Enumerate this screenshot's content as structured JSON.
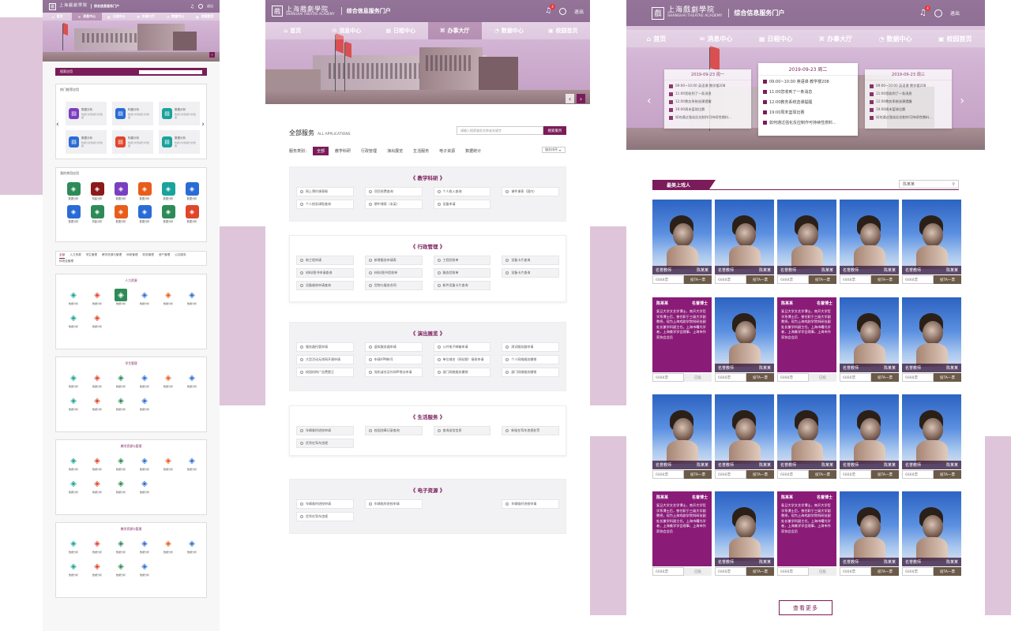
{
  "brand": {
    "cn": "上海戲劇學院",
    "en": "SHANGHAI THEATRE ACADEMY",
    "portal": "综合信息服务门户",
    "logout": "退出",
    "badge": "4",
    "small_title": "综合信息服务门户"
  },
  "nav": [
    {
      "label": "首页",
      "icon": "home-icon"
    },
    {
      "label": "消息中心",
      "icon": "message-icon"
    },
    {
      "label": "日程中心",
      "icon": "calendar-icon"
    },
    {
      "label": "办事大厅",
      "icon": "hall-icon"
    },
    {
      "label": "数据中心",
      "icon": "data-icon"
    },
    {
      "label": "校园首页",
      "icon": "campus-icon"
    }
  ],
  "left": {
    "search_label": "搜索应用",
    "popular_title": "热门推荐应用",
    "popular": [
      {
        "name": "数据分析",
        "desc": "数据分析数据分析数据"
      },
      {
        "name": "构建分析",
        "desc": "数据分析数据分析数据"
      },
      {
        "name": "数据分析",
        "desc": "数据分析数据分析数据"
      },
      {
        "name": "数据分析",
        "desc": "数据分析数据分析数据"
      },
      {
        "name": "构建分析",
        "desc": "数据分析数据分析数据"
      },
      {
        "name": "数据分析",
        "desc": "数据分析数据分析数据"
      }
    ],
    "common_title": "我的常用应用",
    "common": [
      {
        "name": "数据分析",
        "color": "#2e8b57"
      },
      {
        "name": "构建分析",
        "color": "#8b1a1a"
      },
      {
        "name": "数据分析",
        "color": "#7a3fc0"
      },
      {
        "name": "数据分析",
        "color": "#e85d1c"
      },
      {
        "name": "数据分析",
        "color": "#1aa39a"
      },
      {
        "name": "数据分析",
        "color": "#2a6cd6"
      },
      {
        "name": "数据分析",
        "color": "#2a6cd6"
      },
      {
        "name": "构建分析",
        "color": "#2e8b57"
      },
      {
        "name": "数据分析",
        "color": "#e85d1c"
      },
      {
        "name": "数据分析",
        "color": "#2a6cd6"
      },
      {
        "name": "数据分析",
        "color": "#2e8b57"
      },
      {
        "name": "数据分析",
        "color": "#e0462c"
      }
    ],
    "tabs": [
      "全部",
      "人力资源",
      "学生管理",
      "教学资源与管理",
      "科研管理",
      "财务管理",
      "资产管理",
      "公共服务",
      "科研及管理"
    ],
    "groups": [
      {
        "title": "人力资源"
      },
      {
        "title": "学生管理"
      },
      {
        "title": "教学资源与管理"
      },
      {
        "title": "教学资源与管理"
      }
    ],
    "tile_name": "数据分析"
  },
  "mid": {
    "section_title": "全部服务",
    "section_en": "ALL APPLICATIONS",
    "search_placeholder": "请输入搜索服务名称或关键字",
    "search_btn": "搜索服务",
    "filter_label": "服务类别：",
    "filters": [
      "全部",
      "教学科研",
      "行政管理",
      "演出展览",
      "生活服务",
      "电子资源",
      "数据统计"
    ],
    "sort": "服务排序",
    "blocks": [
      {
        "title": "教学科研",
        "items": [
          "网上预约课表制",
          "项目经费查询",
          "个人收入查询",
          "课件课表（国内）",
          "个人校务津贴查询",
          "期中课表（本英）",
          "设备申请"
        ]
      },
      {
        "title": "行政管理",
        "items": [
          "新工程申请",
          "新增服务申请表",
          "工程验收单",
          "设备卡片查询",
          "材料/图书申请查询",
          "材料/图书验收单",
          "服务验收单",
          "设备卡片查询",
          "设备维修申请查询",
          "货物与服务合同",
          "新件设备卡片查询"
        ]
      },
      {
        "title": "演出展览",
        "items": [
          "服务器托管申请",
          "虚拟服务器申请",
          "公共电子邮箱申请",
          "测试服务器申请",
          "大型活动无线网开通申请",
          "申请VPN帐号",
          "单位域名（网站群）接收申请",
          "个人网络服务撤销",
          "校园机构广告费更正",
          "党机或名及外网IP地址申请",
          "部门网络服务撤销",
          "部门网络服务撤销"
        ]
      },
      {
        "title": "生活服务",
        "items": [
          "车辆临时进校申请",
          "校园违章记录查询",
          "查询送信信息",
          "新临在驾车违规处罚",
          "优秀在驾车违规"
        ]
      },
      {
        "title": "电子资源",
        "items": [
          "车辆临时进校申请",
          "车辆临时进校申请",
          "",
          "车辆临时进校申请",
          "优秀在驾车违规"
        ]
      }
    ]
  },
  "right": {
    "schedules": [
      {
        "date": "2019-09-23 周二",
        "items": [
          "09:00~10:00 英语课 教学楼208",
          "11:00您收到了一条消息",
          "12:00教务系统选课提醒",
          "19:00周末篮球比赛",
          "如何通过强化反应制作可持续性燃料..."
        ]
      },
      {
        "date": "2019-09-23 周一",
        "items": [
          "09:00~10:00 英语课 教学楼208",
          "11:00您收到了一条消息",
          "12:00教务系统选课提醒",
          "19:00周末篮球比赛",
          "如何通过强化反应制作可持续性燃料..."
        ]
      },
      {
        "date": "2019-09-23 周三",
        "items": [
          "09:00~10:00 英语课 教学楼208",
          "11:00您收到了一条消息",
          "12:00教务系统选课提醒",
          "19:00周末篮球比赛",
          "如何通过强化反应制作可持续性燃料..."
        ]
      }
    ],
    "section_title": "最美上戏人",
    "search_placeholder": "陈某某",
    "person": {
      "title": "名誉教师",
      "name": "陈某某",
      "role": "名誉博士",
      "bio": "复旦大学文艺学博士，南开大学哲学系博士后，曾任职于三级大学副教授，现为上海戏剧学院科研处副处长兼学科副主任。上海市曙光学者，上海美学学会理事，上海市作家协会会员"
    },
    "vote_count": "6888票",
    "vote_btn": "投TA一票",
    "voted": "已投",
    "grid_layout": [
      [
        "p",
        "p",
        "p",
        "p",
        "p"
      ],
      [
        "b",
        "p",
        "b",
        "p",
        "p"
      ],
      [
        "p",
        "p",
        "p",
        "p",
        "p"
      ],
      [
        "b",
        "p",
        "b",
        "p",
        "p"
      ]
    ],
    "grid_voted": [
      [
        false,
        false,
        false,
        false,
        false
      ],
      [
        true,
        false,
        true,
        false,
        false
      ],
      [
        false,
        false,
        false,
        false,
        false
      ],
      [
        true,
        false,
        true,
        false,
        false
      ]
    ],
    "more": "查看更多"
  },
  "colors": {
    "accent": "#7a1c5a",
    "deco": "#dfc5d9"
  }
}
